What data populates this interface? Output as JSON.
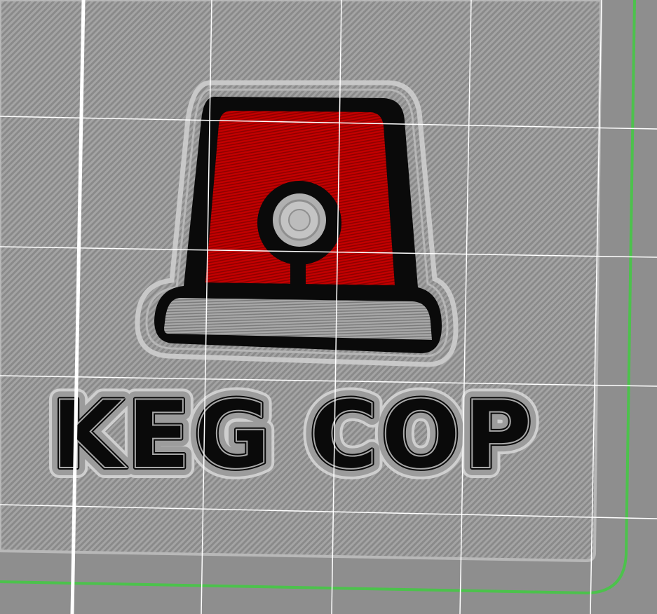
{
  "print": {
    "label_text": "KEG COP",
    "icon": "siren-light-icon"
  },
  "colors": {
    "bed": "#8e8e8e",
    "plate": "#a3a3a3",
    "outline": "#0a0a0a",
    "dome": "#c20000",
    "base_fill": "#9a9a9a",
    "bed_edge": "#4cc24c",
    "grid": "#ffffff"
  }
}
